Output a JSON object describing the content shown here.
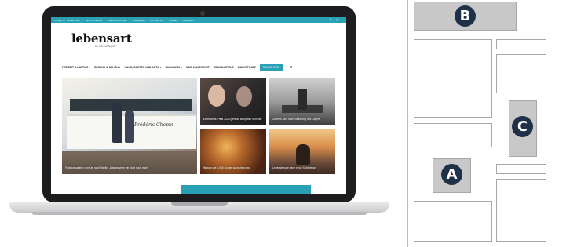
{
  "website": {
    "topbar": {
      "items": [
        "Freitag, 27. Januar 2023",
        "PEFC zertifiziert",
        "Lebensart im Netz",
        "Mediadaten",
        "Wir über uns",
        "Kontakt",
        "Newsletter"
      ],
      "icons": [
        "facebook-icon",
        "instagram-icon"
      ]
    },
    "logo": {
      "name": "lebensart",
      "tagline": "Das Lebensart-Magazin"
    },
    "nav": {
      "items": [
        "FREIZEIT & KULTUR ▾",
        "GESUND & SCHÖN ▾",
        "HAUS, GARTEN UND AUTO ▾",
        "KULINARIK ▾",
        "NACHHALTIGKEIT",
        "GEWINNSPIELE",
        "MARKTPLATZ"
      ],
      "cta": "ONLINE SHOP",
      "search_icon": "search-icon"
    },
    "tiles": {
      "main": {
        "caption": "Flusskreuzfahrt von Kiel nach Berlin: „Das machen wir glatt noch mal!“",
        "ship_name": "Frédéric Chopin"
      },
      "tile2": {
        "caption": "Ehrenamts-Preis 2023 geht an Benjamin Scheuer"
      },
      "tile3": {
        "caption": "Zweites Jahr nach Befreiung des Lagers"
      },
      "tile4": {
        "caption": "Warum die 1.000 Lichter so wichtig sind"
      },
      "tile5": {
        "caption": "Lebensfreude: eine neue Sichtweise"
      }
    }
  },
  "wireframe": {
    "badges": {
      "a": "A",
      "b": "B",
      "c": "C"
    }
  },
  "colors": {
    "accent": "#2aa0b4",
    "badge": "#1f3049",
    "frame": "#1d1d1f"
  }
}
